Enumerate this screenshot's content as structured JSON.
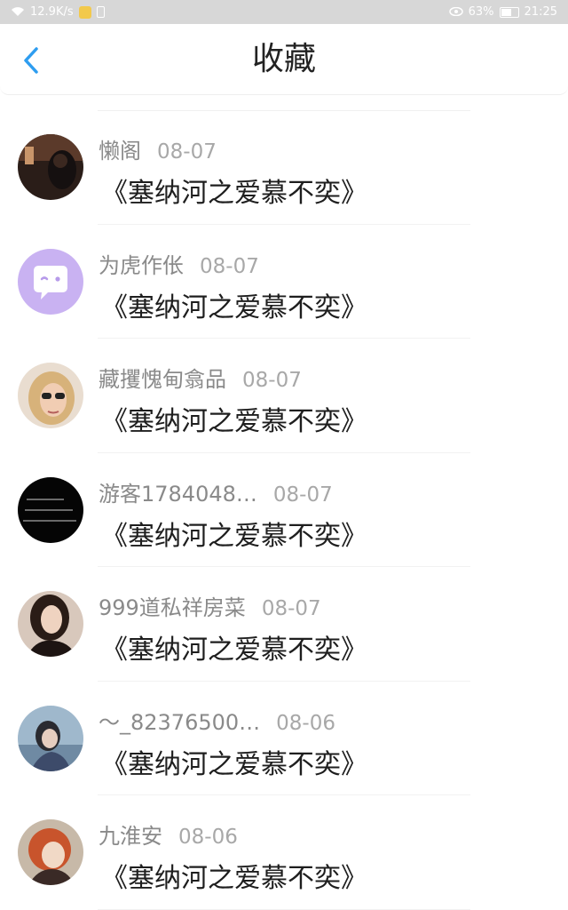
{
  "status_bar": {
    "network_speed": "12.9K/s",
    "battery_percent": "63%",
    "time": "21:25",
    "icons": [
      "wifi-icon",
      "app-notification-icon",
      "sim-icon",
      "eye-icon",
      "battery-icon"
    ],
    "battery_level": 0.63
  },
  "header": {
    "title": "收藏",
    "back_icon": "chevron-left-icon",
    "accent_color": "#2e9df0"
  },
  "items": [
    {
      "username": "懒阁",
      "date": "08-07",
      "book_title": "《塞纳河之爱慕不奕》",
      "avatar": "photo-avatar"
    },
    {
      "username": "为虎作伥",
      "date": "08-07",
      "book_title": "《塞纳河之爱慕不奕》",
      "avatar": "default-chat-avatar"
    },
    {
      "username": "藏攫愧甸翕品",
      "date": "08-07",
      "book_title": "《塞纳河之爱慕不奕》",
      "avatar": "photo-avatar"
    },
    {
      "username": "游客1784048…",
      "date": "08-07",
      "book_title": "《塞纳河之爱慕不奕》",
      "avatar": "text-photo-avatar"
    },
    {
      "username": "999道私祥房菜",
      "date": "08-07",
      "book_title": "《塞纳河之爱慕不奕》",
      "avatar": "photo-avatar"
    },
    {
      "username": "～_82376500…",
      "date": "08-06",
      "book_title": "《塞纳河之爱慕不奕》",
      "avatar": "photo-avatar"
    },
    {
      "username": "九淮安",
      "date": "08-06",
      "book_title": "《塞纳河之爱慕不奕》",
      "avatar": "anime-avatar"
    }
  ]
}
